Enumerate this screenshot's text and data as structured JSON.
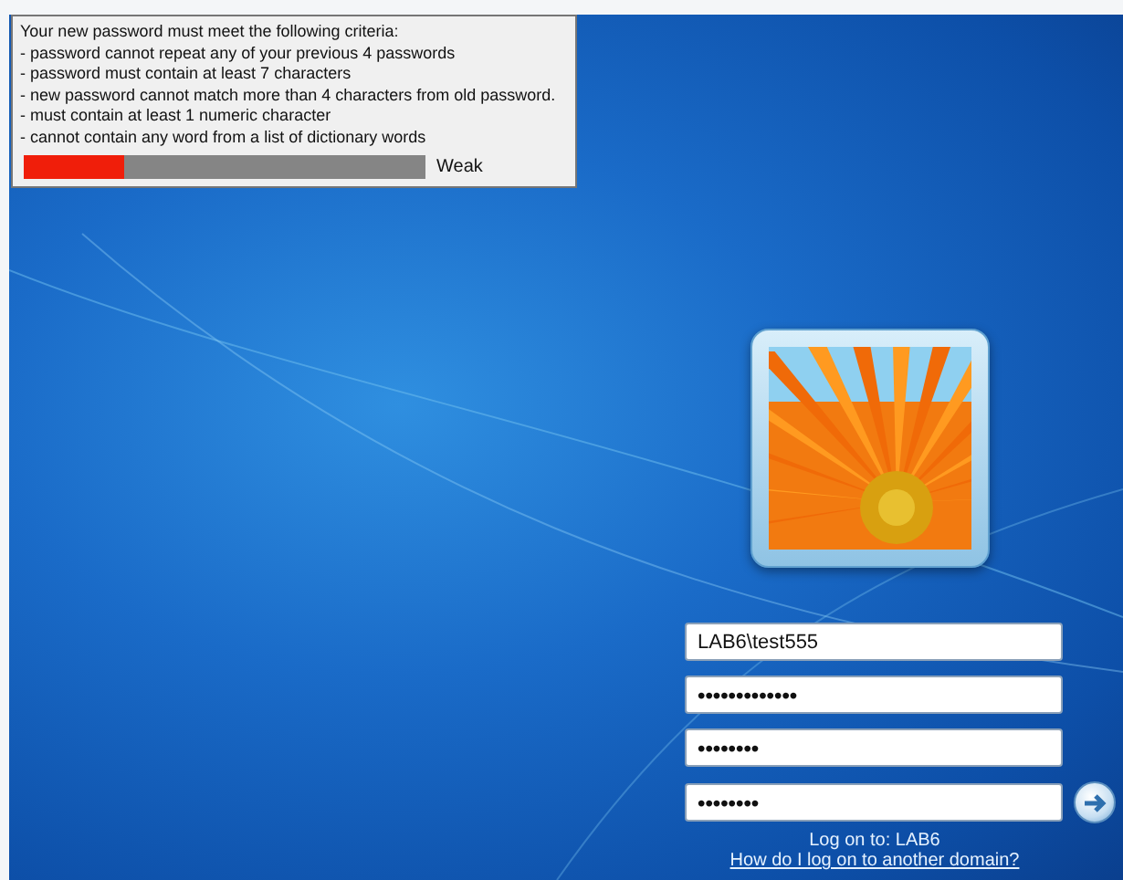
{
  "criteria_tooltip": {
    "heading": "Your new password must meet the following criteria:",
    "rules": [
      " - password cannot repeat any of your previous 4 passwords",
      " - password must contain at least 7 characters",
      " - new password cannot match more than 4 characters from old password.",
      " - must contain at least 1 numeric character",
      " - cannot contain any word from a list of dictionary words"
    ],
    "strength": {
      "level": 0.25,
      "label": "Weak"
    }
  },
  "logon": {
    "fields": [
      {
        "kind": "text",
        "value": "LAB6\\test555"
      },
      {
        "kind": "password",
        "value": "•••••••••••••"
      },
      {
        "kind": "password",
        "value": "••••••••"
      },
      {
        "kind": "password",
        "value": "••••••••"
      }
    ],
    "logon_to": "Log on to: LAB6",
    "link": "How do I log on to another domain?"
  }
}
